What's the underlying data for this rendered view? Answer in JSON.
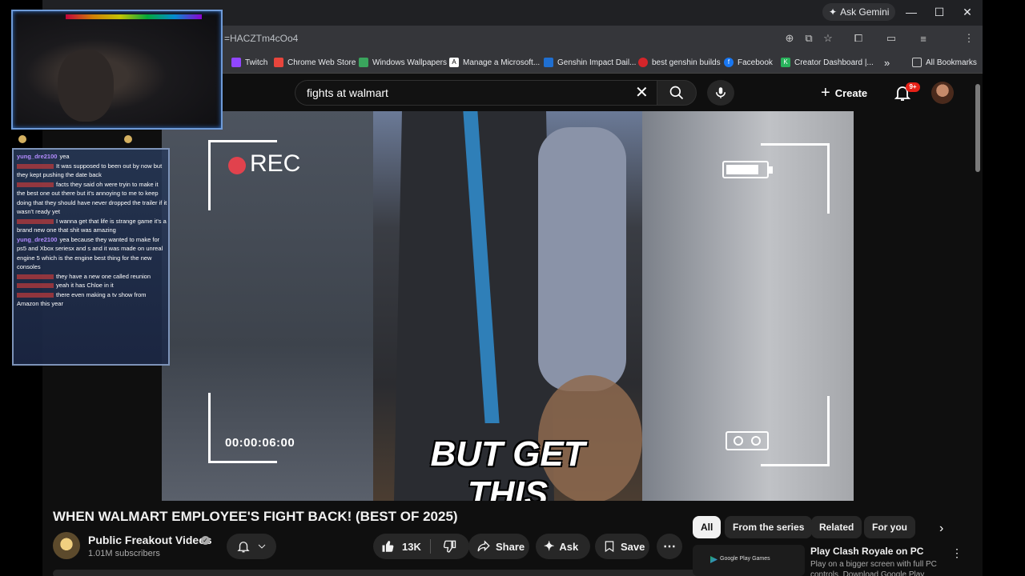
{
  "browser": {
    "gemini_label": "Ask Gemini",
    "url_fragment": "=HACZTm4cOo4",
    "bookmarks": [
      {
        "label": "Twitch",
        "color": "#9146ff"
      },
      {
        "label": "Chrome Web Store",
        "color": "#e8453c"
      },
      {
        "label": "Windows Wallpapers",
        "color": "#3aa55d"
      },
      {
        "label": "Manage a Microsoft...",
        "color": "#222222"
      },
      {
        "label": "Genshin Impact Dail...",
        "color": "#1f6fd1"
      },
      {
        "label": "best genshin builds",
        "color": "#d4252a"
      },
      {
        "label": "Facebook",
        "color": "#1877f2"
      },
      {
        "label": "Creator Dashboard |...",
        "color": "#29b35c"
      }
    ],
    "more_bookmarks": "»",
    "all_bookmarks": "All Bookmarks"
  },
  "youtube": {
    "search_value": "fights at walmart",
    "create_label": "Create",
    "notif_badge": "9+"
  },
  "video": {
    "rec_label": "REC",
    "timecode": "00:00:06:00",
    "caption": "BUT GET THIS",
    "title": "WHEN WALMART EMPLOYEE'S FIGHT BACK! (BEST OF 2025)"
  },
  "channel": {
    "name": "Public Freakout Videos",
    "subscribers": "1.01M subscribers"
  },
  "actions": {
    "like_count": "13K",
    "share_label": "Share",
    "ask_label": "Ask",
    "save_label": "Save"
  },
  "chips": [
    "All",
    "From the series",
    "Related",
    "For you"
  ],
  "recommendation": {
    "thumb_text": "Google Play Games",
    "title": "Play Clash Royale on PC",
    "description": "Play on a bigger screen with full PC controls. Download Google Play"
  },
  "chat": [
    {
      "user": "yung_dre2100",
      "color": "#b38cff",
      "text": "yea"
    },
    {
      "user": " ",
      "color": "#c23b3b",
      "text": "It was supposed to been out by now but they kept pushing the date back"
    },
    {
      "user": " ",
      "color": "#c23b3b",
      "text": "facts they said oh were tryin to make it the best one out there but it's annoying to me to keep doing that they should have never dropped the trailer if it wasn't ready yet"
    },
    {
      "user": " ",
      "color": "#c23b3b",
      "text": "I wanna get that life is strange game it's a brand new one that shit was amazing"
    },
    {
      "user": "yung_dre2100",
      "color": "#b38cff",
      "text": "yea because they wanted to make for ps5 and Xbox seriesx and s and it was made on unreal engine 5 which is the engine best thing for the new consoles"
    },
    {
      "user": " ",
      "color": "#c23b3b",
      "text": "they have a new one called reunion"
    },
    {
      "user": " ",
      "color": "#c23b3b",
      "text": "yeah it has Chloe in it"
    },
    {
      "user": " ",
      "color": "#c23b3b",
      "text": "there even making a tv show from Amazon this year"
    }
  ]
}
